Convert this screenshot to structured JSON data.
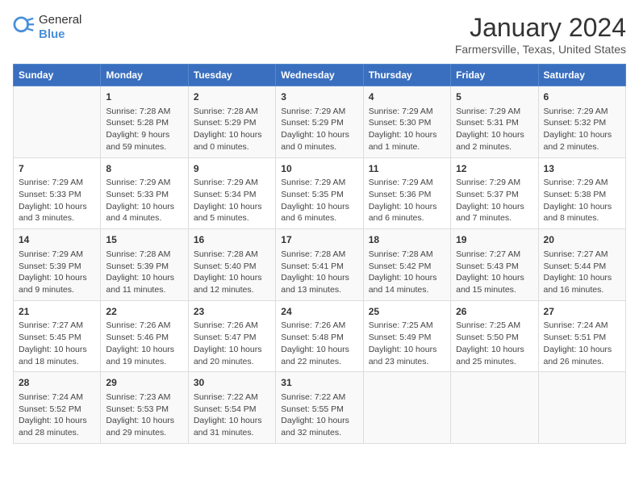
{
  "logo": {
    "line1": "General",
    "line2": "Blue"
  },
  "title": "January 2024",
  "subtitle": "Farmersville, Texas, United States",
  "weekdays": [
    "Sunday",
    "Monday",
    "Tuesday",
    "Wednesday",
    "Thursday",
    "Friday",
    "Saturday"
  ],
  "rows": [
    [
      {
        "day": "",
        "info": ""
      },
      {
        "day": "1",
        "info": "Sunrise: 7:28 AM\nSunset: 5:28 PM\nDaylight: 9 hours\nand 59 minutes."
      },
      {
        "day": "2",
        "info": "Sunrise: 7:28 AM\nSunset: 5:29 PM\nDaylight: 10 hours\nand 0 minutes."
      },
      {
        "day": "3",
        "info": "Sunrise: 7:29 AM\nSunset: 5:29 PM\nDaylight: 10 hours\nand 0 minutes."
      },
      {
        "day": "4",
        "info": "Sunrise: 7:29 AM\nSunset: 5:30 PM\nDaylight: 10 hours\nand 1 minute."
      },
      {
        "day": "5",
        "info": "Sunrise: 7:29 AM\nSunset: 5:31 PM\nDaylight: 10 hours\nand 2 minutes."
      },
      {
        "day": "6",
        "info": "Sunrise: 7:29 AM\nSunset: 5:32 PM\nDaylight: 10 hours\nand 2 minutes."
      }
    ],
    [
      {
        "day": "7",
        "info": "Sunrise: 7:29 AM\nSunset: 5:33 PM\nDaylight: 10 hours\nand 3 minutes."
      },
      {
        "day": "8",
        "info": "Sunrise: 7:29 AM\nSunset: 5:33 PM\nDaylight: 10 hours\nand 4 minutes."
      },
      {
        "day": "9",
        "info": "Sunrise: 7:29 AM\nSunset: 5:34 PM\nDaylight: 10 hours\nand 5 minutes."
      },
      {
        "day": "10",
        "info": "Sunrise: 7:29 AM\nSunset: 5:35 PM\nDaylight: 10 hours\nand 6 minutes."
      },
      {
        "day": "11",
        "info": "Sunrise: 7:29 AM\nSunset: 5:36 PM\nDaylight: 10 hours\nand 6 minutes."
      },
      {
        "day": "12",
        "info": "Sunrise: 7:29 AM\nSunset: 5:37 PM\nDaylight: 10 hours\nand 7 minutes."
      },
      {
        "day": "13",
        "info": "Sunrise: 7:29 AM\nSunset: 5:38 PM\nDaylight: 10 hours\nand 8 minutes."
      }
    ],
    [
      {
        "day": "14",
        "info": "Sunrise: 7:29 AM\nSunset: 5:39 PM\nDaylight: 10 hours\nand 9 minutes."
      },
      {
        "day": "15",
        "info": "Sunrise: 7:28 AM\nSunset: 5:39 PM\nDaylight: 10 hours\nand 11 minutes."
      },
      {
        "day": "16",
        "info": "Sunrise: 7:28 AM\nSunset: 5:40 PM\nDaylight: 10 hours\nand 12 minutes."
      },
      {
        "day": "17",
        "info": "Sunrise: 7:28 AM\nSunset: 5:41 PM\nDaylight: 10 hours\nand 13 minutes."
      },
      {
        "day": "18",
        "info": "Sunrise: 7:28 AM\nSunset: 5:42 PM\nDaylight: 10 hours\nand 14 minutes."
      },
      {
        "day": "19",
        "info": "Sunrise: 7:27 AM\nSunset: 5:43 PM\nDaylight: 10 hours\nand 15 minutes."
      },
      {
        "day": "20",
        "info": "Sunrise: 7:27 AM\nSunset: 5:44 PM\nDaylight: 10 hours\nand 16 minutes."
      }
    ],
    [
      {
        "day": "21",
        "info": "Sunrise: 7:27 AM\nSunset: 5:45 PM\nDaylight: 10 hours\nand 18 minutes."
      },
      {
        "day": "22",
        "info": "Sunrise: 7:26 AM\nSunset: 5:46 PM\nDaylight: 10 hours\nand 19 minutes."
      },
      {
        "day": "23",
        "info": "Sunrise: 7:26 AM\nSunset: 5:47 PM\nDaylight: 10 hours\nand 20 minutes."
      },
      {
        "day": "24",
        "info": "Sunrise: 7:26 AM\nSunset: 5:48 PM\nDaylight: 10 hours\nand 22 minutes."
      },
      {
        "day": "25",
        "info": "Sunrise: 7:25 AM\nSunset: 5:49 PM\nDaylight: 10 hours\nand 23 minutes."
      },
      {
        "day": "26",
        "info": "Sunrise: 7:25 AM\nSunset: 5:50 PM\nDaylight: 10 hours\nand 25 minutes."
      },
      {
        "day": "27",
        "info": "Sunrise: 7:24 AM\nSunset: 5:51 PM\nDaylight: 10 hours\nand 26 minutes."
      }
    ],
    [
      {
        "day": "28",
        "info": "Sunrise: 7:24 AM\nSunset: 5:52 PM\nDaylight: 10 hours\nand 28 minutes."
      },
      {
        "day": "29",
        "info": "Sunrise: 7:23 AM\nSunset: 5:53 PM\nDaylight: 10 hours\nand 29 minutes."
      },
      {
        "day": "30",
        "info": "Sunrise: 7:22 AM\nSunset: 5:54 PM\nDaylight: 10 hours\nand 31 minutes."
      },
      {
        "day": "31",
        "info": "Sunrise: 7:22 AM\nSunset: 5:55 PM\nDaylight: 10 hours\nand 32 minutes."
      },
      {
        "day": "",
        "info": ""
      },
      {
        "day": "",
        "info": ""
      },
      {
        "day": "",
        "info": ""
      }
    ]
  ]
}
